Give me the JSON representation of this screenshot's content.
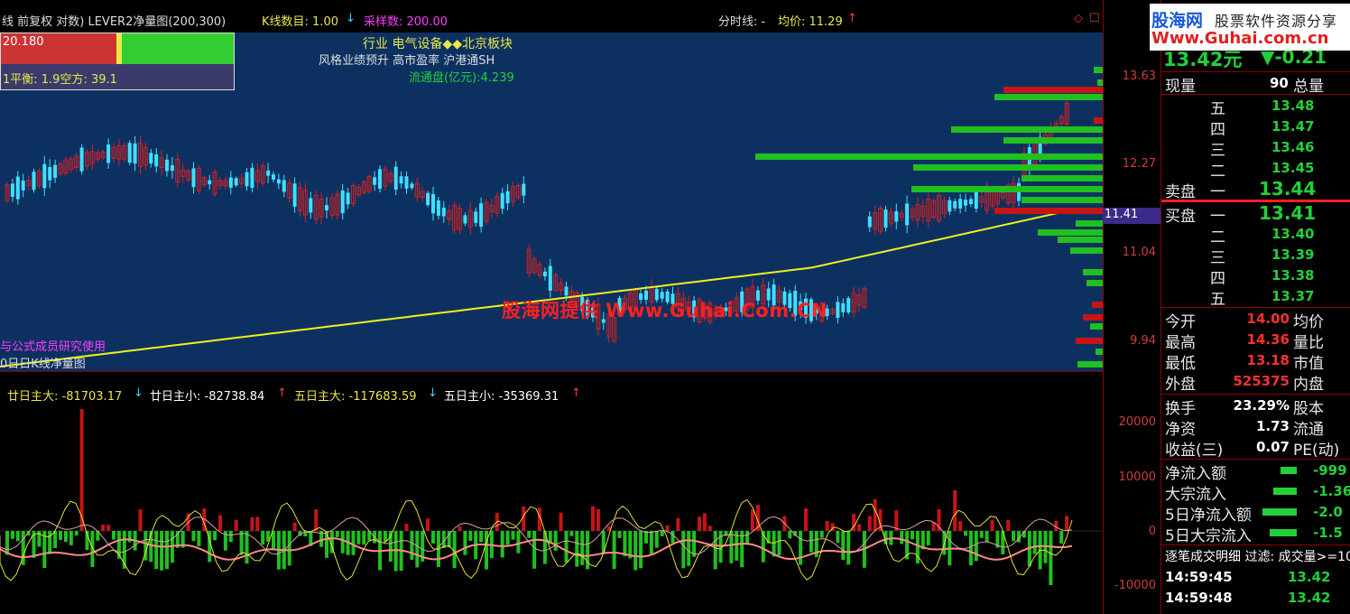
{
  "header": {
    "title_part1": "线 前复权 对数) LEVER2净量图(200,300)",
    "kline_label": "K线数目: 1.00",
    "kline_arrow": "↓",
    "sample_label": "采样数: 200.00",
    "fenshi_label": "分时线: -",
    "avg_label": "均价: 11.29",
    "avg_arrow": "↑",
    "icons_right": [
      "◇",
      "☐"
    ]
  },
  "infobox": {
    "value": "20.180",
    "balance": "1平衡: 1.9空方: 39.1"
  },
  "stock_info": {
    "line1": "行业 电气设备◆◆北京板块",
    "line2": "风格业绩预升 高市盈率 沪港通SH",
    "line3": "流通盘(亿元):4.239"
  },
  "watermark_center": "股海网提供 Www.Guhai.Com.CN",
  "left_notes": {
    "note1": "与公式成员研究使用",
    "note2": "0日日K线净量图"
  },
  "sub_header": {
    "items": [
      {
        "label": "廿日主大: -81703.17",
        "arrow": "↓",
        "color": "#e8e84a",
        "arrowColor": "#3ad0ff"
      },
      {
        "label": "廿日主小: -82738.84",
        "arrow": "↑",
        "color": "#ffffff",
        "arrowColor": "#ff3a3a"
      },
      {
        "label": "五日主大: -117683.59",
        "arrow": "↓",
        "color": "#e8e84a",
        "arrowColor": "#3ad0ff"
      },
      {
        "label": "五日主小: -35369.31",
        "arrow": "↑",
        "color": "#ffffff",
        "arrowColor": "#ff3a3a"
      }
    ]
  },
  "axis_main": [
    "13.63",
    "12.27",
    "11.41",
    "11.04",
    "9.94"
  ],
  "axis_sub": [
    "20000",
    "10000",
    "0",
    "-10000"
  ],
  "logo": {
    "brand": "股海网",
    "tagline": "股票软件资源分享",
    "url": "Www.Guhai.com.cn"
  },
  "quote_panel": {
    "price": "13.42元",
    "change": "▼-0.21",
    "now_label": "现量",
    "now_value": "90",
    "total_label": "总量",
    "sell_levels": [
      {
        "label": "五",
        "price": "13.48"
      },
      {
        "label": "四",
        "price": "13.47"
      },
      {
        "label": "三",
        "price": "13.46"
      },
      {
        "label": "二",
        "price": "13.45"
      }
    ],
    "sell1_label": "卖盘",
    "sell1_idx": "一",
    "sell1_price": "13.44",
    "buy1_label": "买盘",
    "buy1_idx": "一",
    "buy1_price": "13.41",
    "buy_levels": [
      {
        "label": "二",
        "price": "13.40"
      },
      {
        "label": "三",
        "price": "13.39"
      },
      {
        "label": "四",
        "price": "13.38"
      },
      {
        "label": "五",
        "price": "13.37"
      }
    ],
    "stats": [
      {
        "l1": "今开",
        "v1": "14.00",
        "l2": "均价"
      },
      {
        "l1": "最高",
        "v1": "14.36",
        "l2": "量比"
      },
      {
        "l1": "最低",
        "v1": "13.18",
        "l2": "市值"
      },
      {
        "l1": "外盘",
        "v1": "525375",
        "l2": "内盘"
      }
    ],
    "stats2": [
      {
        "l1": "换手",
        "v1": "23.29%",
        "l2": "股本"
      },
      {
        "l1": "净资",
        "v1": "1.73",
        "l2": "流通"
      },
      {
        "l1": "收益(三)",
        "v1": "0.07",
        "l2": "PE(动)"
      }
    ],
    "flows": [
      {
        "label": "净流入额",
        "value": "-999"
      },
      {
        "label": "大宗流入",
        "value": "-1.36"
      },
      {
        "label": "5日净流入额",
        "value": "-2.0"
      },
      {
        "label": "5日大宗流入",
        "value": "-1.5"
      }
    ],
    "ticks_header": "逐笔成交明细 过滤: 成交量>=10",
    "ticks": [
      {
        "time": "14:59:45",
        "price": "13.42"
      },
      {
        "time": "14:59:48",
        "price": "13.42"
      }
    ]
  },
  "colors": {
    "main_bg": "#0c3161",
    "up": "#d42020",
    "down": "#3fe0ff",
    "ma": "#f0f020",
    "bar_green": "#1fc01f",
    "bar_red": "#c81414",
    "pink": "#ff8a8a",
    "sub_yellow": "#e8e030"
  }
}
